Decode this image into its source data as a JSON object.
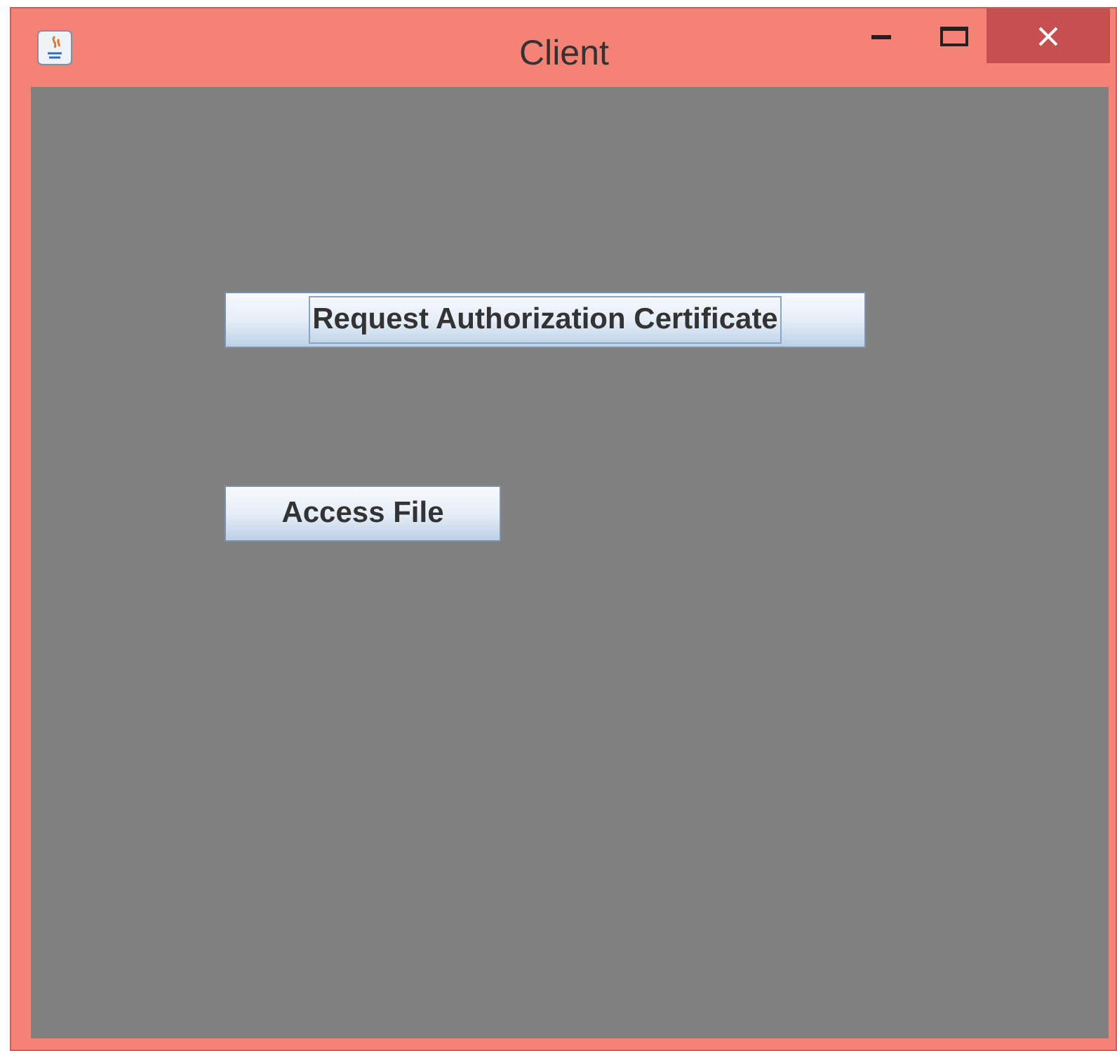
{
  "window": {
    "title": "Client"
  },
  "buttons": [
    {
      "label": "Request Authorization Certificate",
      "focused": true
    },
    {
      "label": "Access File",
      "focused": false
    }
  ]
}
